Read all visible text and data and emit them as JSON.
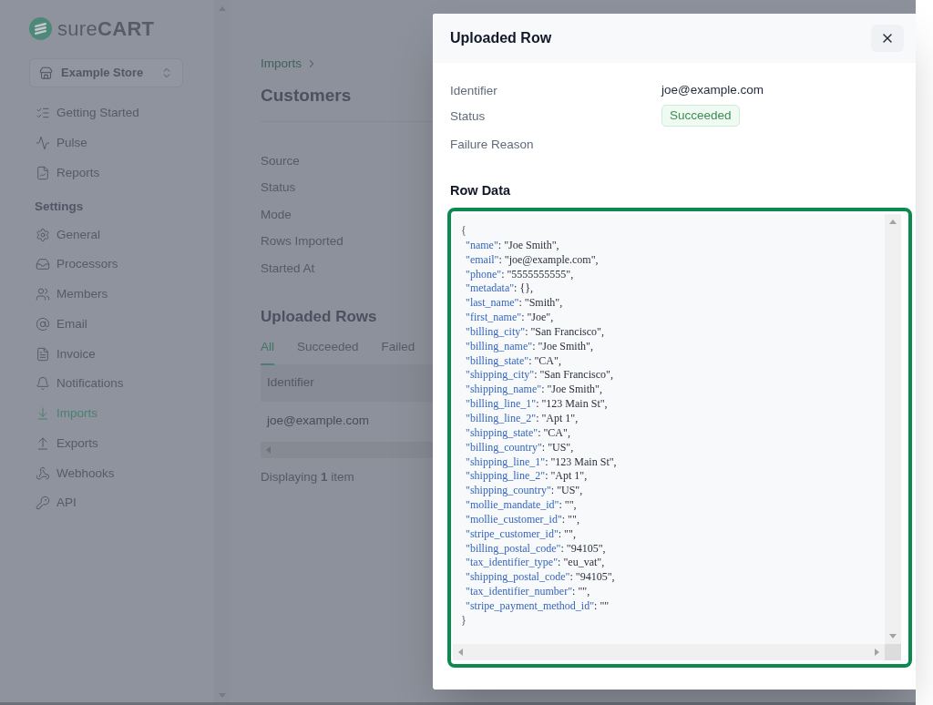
{
  "sidebar": {
    "logo": "sure**CART**",
    "store_selector": {
      "label": "Example Store"
    },
    "nav_items": [
      {
        "label": "Getting Started",
        "selected": false
      },
      {
        "label": "Pulse",
        "selected": false
      },
      {
        "label": "Reports",
        "selected": false
      }
    ],
    "settings": {
      "heading": "Settings",
      "items": [
        {
          "label": "General",
          "selected": false
        },
        {
          "label": "Processors",
          "selected": false
        },
        {
          "label": "Members",
          "selected": false
        },
        {
          "label": "Email",
          "selected": false
        },
        {
          "label": "Invoice",
          "selected": false
        },
        {
          "label": "Notifications",
          "selected": false
        },
        {
          "label": "Imports",
          "selected": true
        },
        {
          "label": "Exports",
          "selected": false
        },
        {
          "label": "Webhooks",
          "selected": false
        },
        {
          "label": "API",
          "selected": false
        }
      ]
    }
  },
  "main": {
    "breadcrumb": {
      "label": "Imports"
    },
    "title": "Customers",
    "details": [
      {
        "label": "Source"
      },
      {
        "label": "Status"
      },
      {
        "label": "Mode"
      },
      {
        "label": "Rows Imported"
      },
      {
        "label": "Started At"
      }
    ],
    "uploaded_rows": {
      "title": "Uploaded Rows",
      "tabs": [
        {
          "label": "All",
          "selected": true
        },
        {
          "label": "Succeeded",
          "selected": false
        },
        {
          "label": "Failed",
          "selected": false
        }
      ],
      "table": {
        "columns": [
          "Identifier"
        ],
        "rows": [
          [
            "joe@example.com"
          ]
        ]
      },
      "footer": "Displaying **1** item"
    }
  },
  "modal": {
    "title": "Uploaded Row",
    "fields": [
      {
        "label": "Identifier",
        "kind": "text",
        "value": "joe@example.com"
      },
      {
        "label": "Status",
        "kind": "badge",
        "value": "Succeeded"
      },
      {
        "label": "Failure Reason",
        "kind": "text"
      }
    ],
    "row_data": {
      "title": "Row Data",
      "focused": true,
      "open": "{",
      "lines": [
        {
          "key": "\"name\"",
          "value": ": \"Joe Smith\","
        },
        {
          "key": "\"email\"",
          "value": ": \"joe@example.com\","
        },
        {
          "key": "\"phone\"",
          "value": ": \"5555555555\","
        },
        {
          "key": "\"metadata\"",
          "value": ": {},"
        },
        {
          "key": "\"last_name\"",
          "value": ": \"Smith\","
        },
        {
          "key": "\"first_name\"",
          "value": ": \"Joe\","
        },
        {
          "key": "\"billing_city\"",
          "value": ": \"San Francisco\","
        },
        {
          "key": "\"billing_name\"",
          "value": ": \"Joe Smith\","
        },
        {
          "key": "\"billing_state\"",
          "value": ": \"CA\","
        },
        {
          "key": "\"shipping_city\"",
          "value": ": \"San Francisco\","
        },
        {
          "key": "\"shipping_name\"",
          "value": ": \"Joe Smith\","
        },
        {
          "key": "\"billing_line_1\"",
          "value": ": \"123 Main St\","
        },
        {
          "key": "\"billing_line_2\"",
          "value": ": \"Apt 1\","
        },
        {
          "key": "\"shipping_state\"",
          "value": ": \"CA\","
        },
        {
          "key": "\"billing_country\"",
          "value": ": \"US\","
        },
        {
          "key": "\"shipping_line_1\"",
          "value": ": \"123 Main St\","
        },
        {
          "key": "\"shipping_line_2\"",
          "value": ": \"Apt 1\","
        },
        {
          "key": "\"shipping_country\"",
          "value": ": \"US\","
        },
        {
          "key": "\"mollie_mandate_id\"",
          "value": ": \"\","
        },
        {
          "key": "\"mollie_customer_id\"",
          "value": ": \"\","
        },
        {
          "key": "\"stripe_customer_id\"",
          "value": ": \"\","
        },
        {
          "key": "\"billing_postal_code\"",
          "value": ": \"94105\","
        },
        {
          "key": "\"tax_identifier_type\"",
          "value": ": \"eu_vat\","
        },
        {
          "key": "\"shipping_postal_code\"",
          "value": ": \"94105\","
        },
        {
          "key": "\"tax_identifier_number\"",
          "value": ": \"\","
        },
        {
          "key": "\"stripe_payment_method_id\"",
          "value": ": \"\""
        }
      ],
      "close": "}"
    }
  }
}
